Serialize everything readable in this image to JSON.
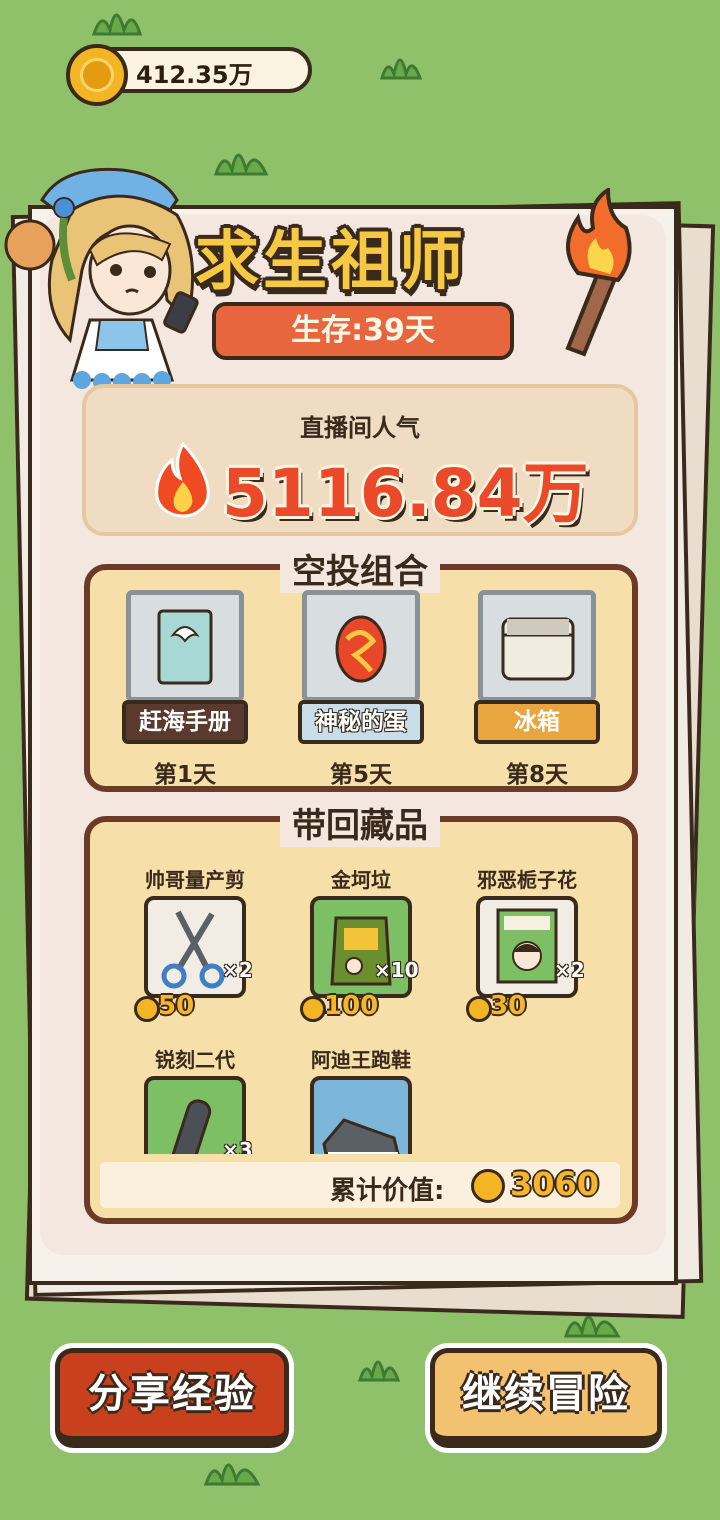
{
  "currency": {
    "amount": "412.35万",
    "icon": "gold-coin-icon"
  },
  "header": {
    "title": "求生祖师",
    "survival_days": "生存:39天"
  },
  "popularity": {
    "label": "直播间人气",
    "value": "5116.84万",
    "icon": "fire-icon"
  },
  "airdrop": {
    "title": "空投组合",
    "items": [
      {
        "name": "赶海手册",
        "day": "第1天",
        "label_bg": "#5a3a2e",
        "label_color": "#ffffff",
        "icon": "book-icon"
      },
      {
        "name": "神秘的蛋",
        "day": "第5天",
        "label_bg": "#c9dde8",
        "label_color": "#ffffff",
        "icon": "egg-icon"
      },
      {
        "name": "冰箱",
        "day": "第8天",
        "label_bg": "#e9a53f",
        "label_color": "#ffffff",
        "icon": "fridge-icon"
      }
    ]
  },
  "collection": {
    "title": "带回藏品",
    "items": [
      {
        "name": "帅哥量产剪",
        "count": "×2",
        "price": "50",
        "card_bg": "#f1ece4",
        "icon": "scissors-icon"
      },
      {
        "name": "金坷垃",
        "count": "×10",
        "price": "100",
        "card_bg": "#7dbf64",
        "icon": "fertilizer-bag-icon"
      },
      {
        "name": "邪恶栀子花",
        "count": "×2",
        "price": "30",
        "card_bg": "#f1ece4",
        "icon": "book-portrait-icon"
      },
      {
        "name": "锐刻二代",
        "count": "×3",
        "price": "",
        "card_bg": "#7dbf64",
        "icon": "vape-icon"
      },
      {
        "name": "阿迪王跑鞋",
        "count": "",
        "price": "",
        "card_bg": "#7cb6d8",
        "icon": "sneaker-icon"
      }
    ],
    "total_label": "累计价值:",
    "total_value": "3060"
  },
  "buttons": {
    "share": "分享经验",
    "continue": "继续冒险"
  },
  "colors": {
    "background": "#8fc06a",
    "accent_red": "#e8663d",
    "gold": "#f6c943",
    "dark_brown": "#3a2a1c"
  }
}
